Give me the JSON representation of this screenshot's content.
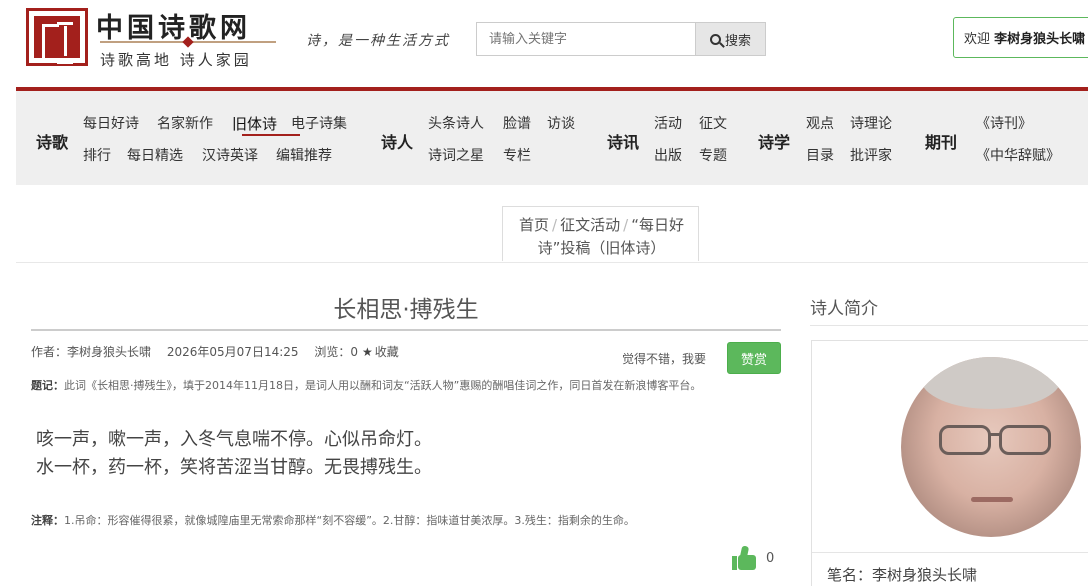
{
  "header": {
    "site_title": "中国诗歌网",
    "site_subtitle": "诗歌高地 诗人家园",
    "slogan": "诗，是一种生活方式",
    "search_placeholder": "请输入关键字",
    "search_button": "搜索",
    "welcome_prefix": "欢迎",
    "welcome_user": "李树身狼头长啸"
  },
  "nav": {
    "poetry": {
      "label": "诗歌",
      "row1": [
        "每日好诗",
        "名家新作",
        "旧体诗",
        "电子诗集"
      ],
      "row2": [
        "排行",
        "每日精选",
        "汉诗英译",
        "编辑推荐"
      ]
    },
    "poets": {
      "label": "诗人",
      "row1": [
        "头条诗人",
        "脸谱",
        "访谈"
      ],
      "row2": [
        "诗词之星",
        "专栏"
      ]
    },
    "news": {
      "label": "诗讯",
      "row1": [
        "活动",
        "征文"
      ],
      "row2": [
        "出版",
        "专题"
      ]
    },
    "study": {
      "label": "诗学",
      "row1": [
        "观点",
        "诗理论"
      ],
      "row2": [
        "目录",
        "批评家"
      ]
    },
    "journals": {
      "label": "期刊",
      "row1": [
        "《诗刊》"
      ],
      "row2": [
        "《中华辞赋》"
      ]
    },
    "active_item": "旧体诗"
  },
  "breadcrumb": {
    "home": "首页",
    "activity": "征文活动",
    "current": "“每日好诗”投稿（旧体诗）"
  },
  "article": {
    "title": "长相思·搏残生",
    "author_label": "作者：",
    "author": "李树身狼头长啸",
    "datetime": "2026年05月07日14:25",
    "views_label": "浏览：",
    "views": "0",
    "favorite": "收藏",
    "praise_hint": "觉得不错，我要",
    "praise_button": "赞赏",
    "epigraph_label": "题记：",
    "epigraph": "此词《长相思·搏残生》，填于2014年11月18日，是词人用以酬和词友“活跃人物”惠赐的酬唱佳词之作，同日首发在新浪博客平台。",
    "poem_lines": [
      "咳一声，嗽一声，入冬气息喘不停。心似吊命灯。",
      "水一杯，药一杯，笑将苦涩当甘醇。无畏搏残生。"
    ],
    "notes_label": "注释：",
    "notes": "1.吊命：形容催得很紧，就像城隍庙里无常索命那样“刻不容缓”。2.甘醇：指味道甘美浓厚。3.残生：指剩余的生命。",
    "like_count": "0"
  },
  "sidebar": {
    "heading": "诗人简介",
    "pen_name_label": "笔名：",
    "pen_name": "李树身狼头长啸"
  },
  "colors": {
    "brand_red": "#a3201c",
    "praise_green": "#5cb85c",
    "nav_bg": "#efefef"
  }
}
